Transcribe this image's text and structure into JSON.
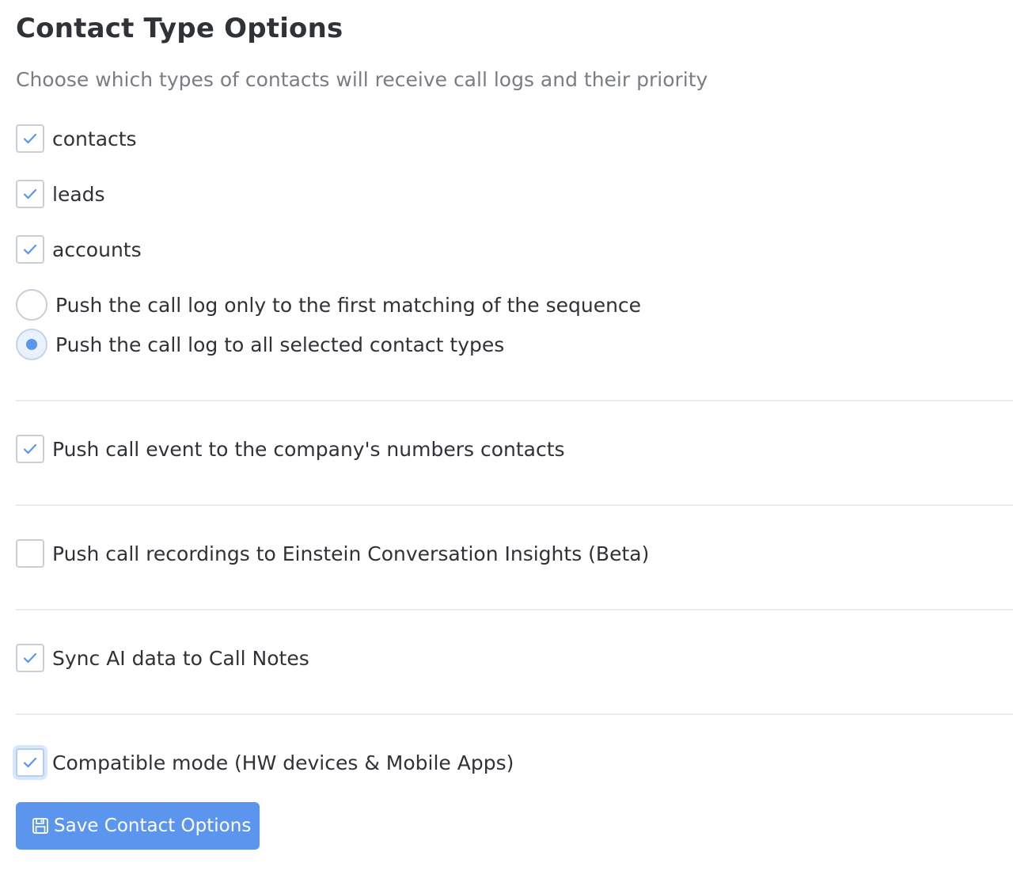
{
  "header": {
    "title": "Contact Type Options",
    "subtitle": "Choose which types of contacts will receive call logs and their priority"
  },
  "contact_types": [
    {
      "label": "contacts",
      "checked": true
    },
    {
      "label": "leads",
      "checked": true
    },
    {
      "label": "accounts",
      "checked": true
    }
  ],
  "push_mode": {
    "options": [
      {
        "label": "Push the call log only to the first matching of the sequence",
        "selected": false
      },
      {
        "label": "Push the call log to all selected contact types",
        "selected": true
      }
    ]
  },
  "settings": {
    "company_numbers": {
      "label": "Push call event to the company's numbers contacts",
      "checked": true
    },
    "einstein": {
      "label": "Push call recordings to Einstein Conversation Insights (Beta)",
      "checked": false
    },
    "ai_sync": {
      "label": "Sync AI data to Call Notes",
      "checked": true
    },
    "compatible_mode": {
      "label": "Compatible mode (HW devices & Mobile Apps)",
      "checked": true
    }
  },
  "actions": {
    "save_label": "Save Contact Options"
  },
  "colors": {
    "accent": "#5b95ee",
    "text": "#2f3237",
    "muted": "#7a7d82",
    "border": "#c9cfd6",
    "divider": "#e9ecef"
  },
  "icons": {
    "checkbox_check": "check-icon",
    "save": "floppy-disk-icon"
  }
}
